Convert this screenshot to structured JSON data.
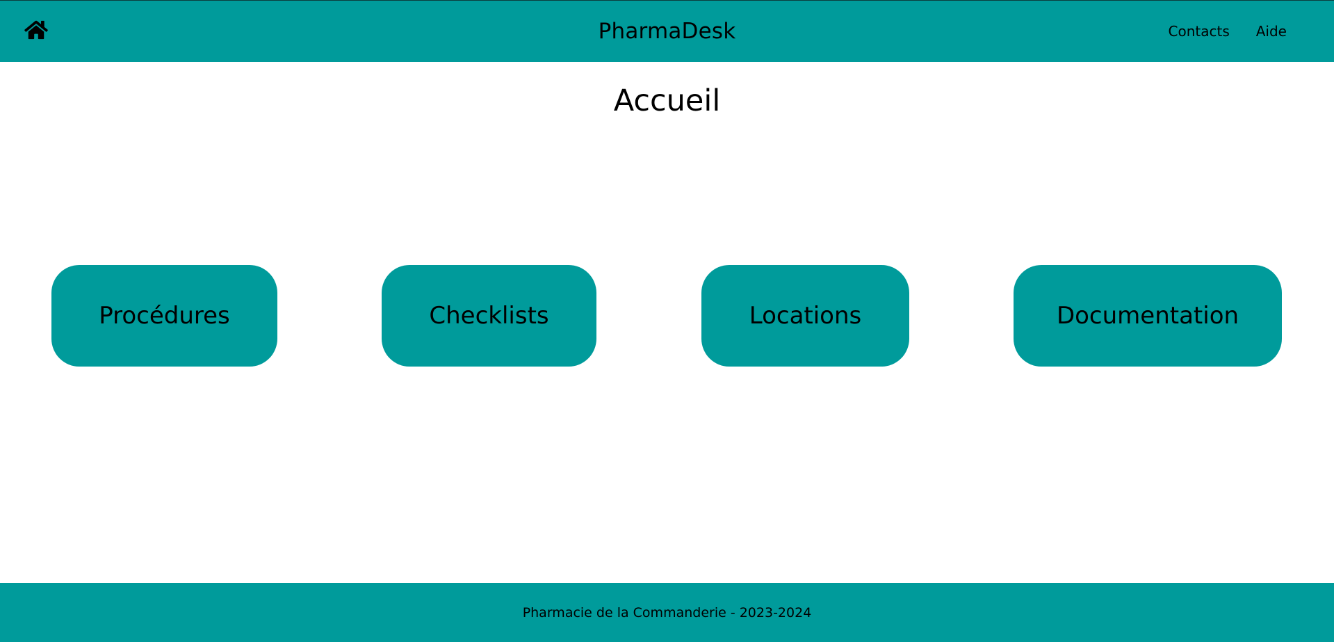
{
  "header": {
    "home_icon": "home-icon",
    "brand": "PharmaDesk",
    "nav": [
      {
        "label": "Contacts"
      },
      {
        "label": "Aide"
      }
    ]
  },
  "main": {
    "title": "Accueil",
    "tiles": [
      {
        "label": "Procédures"
      },
      {
        "label": "Checklists"
      },
      {
        "label": "Locations"
      },
      {
        "label": "Documentation"
      }
    ]
  },
  "footer": {
    "text": "Pharmacie de la Commanderie - 2023-2024"
  },
  "colors": {
    "accent": "#009b9b",
    "background": "#ffffff",
    "text": "#000000"
  }
}
